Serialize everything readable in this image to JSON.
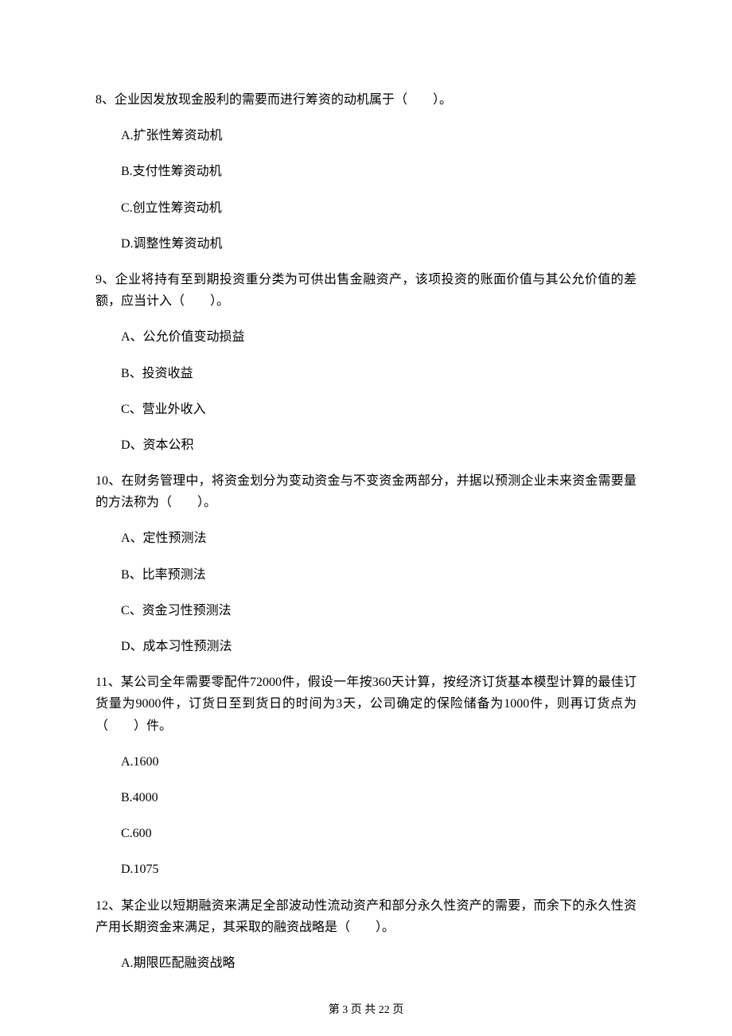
{
  "questions": [
    {
      "stem": "8、企业因发放现金股利的需要而进行筹资的动机属于（　　）。",
      "options": [
        "A.扩张性筹资动机",
        "B.支付性筹资动机",
        "C.创立性筹资动机",
        "D.调整性筹资动机"
      ]
    },
    {
      "stem": "9、企业将持有至到期投资重分类为可供出售金融资产，该项投资的账面价值与其公允价值的差额，应当计入（　　）。",
      "options": [
        "A、公允价值变动损益",
        "B、投资收益",
        "C、营业外收入",
        "D、资本公积"
      ]
    },
    {
      "stem": "10、在财务管理中，将资金划分为变动资金与不变资金两部分，并据以预测企业未来资金需要量的方法称为（　　）。",
      "options": [
        "A、定性预测法",
        "B、比率预测法",
        "C、资金习性预测法",
        "D、成本习性预测法"
      ]
    },
    {
      "stem": "11、某公司全年需要零配件72000件，假设一年按360天计算，按经济订货基本模型计算的最佳订货量为9000件，订货日至到货日的时间为3天，公司确定的保险储备为1000件，则再订货点为（　　）件。",
      "options": [
        "A.1600",
        "B.4000",
        "C.600",
        "D.1075"
      ]
    },
    {
      "stem": "12、某企业以短期融资来满足全部波动性流动资产和部分永久性资产的需要，而余下的永久性资产用长期资金来满足，其采取的融资战略是（　　）。",
      "options": [
        "A.期限匹配融资战略"
      ]
    }
  ],
  "footer": "第 3 页 共 22 页"
}
